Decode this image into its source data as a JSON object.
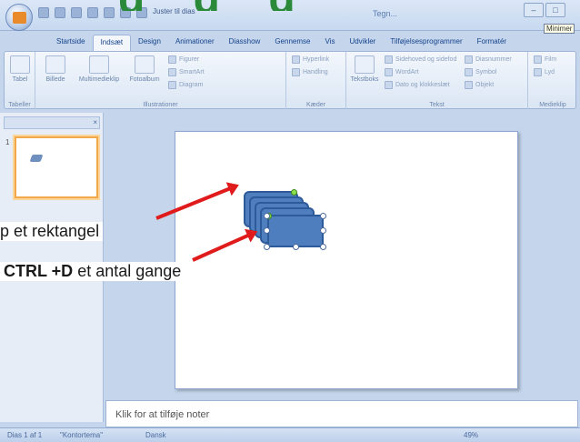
{
  "slide_header_fragment": "g    g    g",
  "window": {
    "title_fragment": "Tegn...",
    "quick_access": "Juster til dias",
    "tooltip": "Minimer"
  },
  "tabs": [
    "Startside",
    "Indsæt",
    "Design",
    "Animationer",
    "Diasshow",
    "Gennemse",
    "Vis",
    "Udvikler",
    "Tilføjelsesprogrammer",
    "Formatér"
  ],
  "ribbon": {
    "groups": {
      "tabeller": "Tabeller",
      "illustrationer": "Illustrationer",
      "kaeder": "Kæder",
      "tekst": "Tekst",
      "medieklip": "Medieklip"
    },
    "commands": {
      "tabel": "Tabel",
      "billede": "Billede",
      "multimedieklip": "Multimedieklip",
      "fotoalbum": "Fotoalbum",
      "figurer": "Figurer",
      "smartart": "SmartArt",
      "diagram": "Diagram",
      "hyperlink": "Hyperlink",
      "handling": "Handling",
      "tekstboks": "Tekstboks",
      "sidehoved": "Sidehoved og sidefod",
      "wordart": "WordArt",
      "dato": "Dato og klokkeslæt",
      "diasnummer": "Diasnummer",
      "symbol": "Symbol",
      "objekt": "Objekt",
      "film": "Film",
      "lyd": "Lyd"
    }
  },
  "left_panel": {
    "thumb_number": "1"
  },
  "notes": {
    "placeholder": "Klik for at tilføje noter"
  },
  "status": {
    "slide": "Dias 1 af 1",
    "theme": "\"Kontortema\"",
    "language": "Dansk",
    "zoom": "49%"
  },
  "annotations": {
    "line1": "p et rektangel",
    "line2_bold": "CTRL +D",
    "line2_rest": " et  antal gange"
  },
  "colors": {
    "arrow": "#e01b1b",
    "shape_fill": "#4f7ebf",
    "accent_title": "#2a8a3a"
  }
}
